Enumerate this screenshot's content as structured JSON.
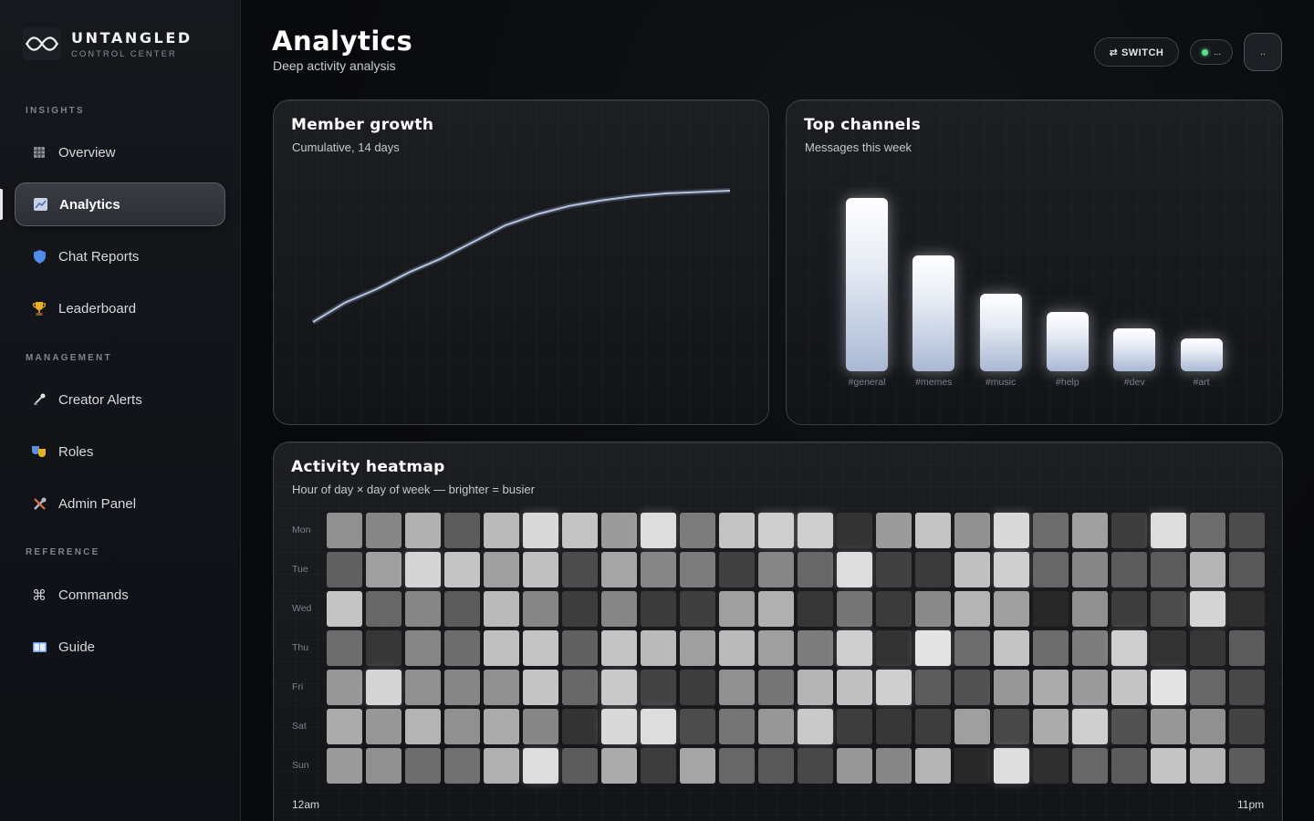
{
  "brand": {
    "name": "UNTANGLED",
    "subtitle": "CONTROL CENTER"
  },
  "sidebar": {
    "sections": [
      {
        "label": "INSIGHTS"
      },
      {
        "label": "MANAGEMENT"
      },
      {
        "label": "REFERENCE"
      }
    ],
    "items": [
      {
        "label": "Overview",
        "icon": "grid-icon"
      },
      {
        "label": "Analytics",
        "icon": "chart-icon",
        "active": true
      },
      {
        "label": "Chat Reports",
        "icon": "shield-icon"
      },
      {
        "label": "Leaderboard",
        "icon": "trophy-icon"
      },
      {
        "label": "Creator Alerts",
        "icon": "satellite-icon"
      },
      {
        "label": "Roles",
        "icon": "masks-icon"
      },
      {
        "label": "Admin Panel",
        "icon": "tools-icon"
      },
      {
        "label": "Commands",
        "icon": "command-icon"
      },
      {
        "label": "Guide",
        "icon": "book-icon"
      }
    ]
  },
  "header": {
    "title": "Analytics",
    "subtitle": "Deep activity analysis",
    "switch_label": "⇄ SWITCH",
    "status_text": "...",
    "avatar_text": ".."
  },
  "member_growth": {
    "title": "Member growth",
    "subtitle": "Cumulative, 14 days",
    "chart_data": {
      "type": "line",
      "x": [
        1,
        2,
        3,
        4,
        5,
        6,
        7,
        8,
        9,
        10,
        11,
        12,
        13,
        14
      ],
      "series": [
        {
          "values": [
            0,
            14,
            24,
            36,
            46,
            58,
            70,
            78,
            84,
            88,
            91,
            93,
            94,
            95
          ]
        }
      ],
      "color": "#b8c4dd"
    }
  },
  "top_channels": {
    "title": "Top channels",
    "subtitle": "Messages this week",
    "chart_data": {
      "type": "bar",
      "categories": [
        "#general",
        "#memes",
        "#music",
        "#help",
        "#dev",
        "#art"
      ],
      "values": [
        100,
        67,
        45,
        34,
        25,
        19
      ]
    }
  },
  "heatmap": {
    "title": "Activity heatmap",
    "subtitle": "Hour of day × day of week — brighter = busier",
    "x_start_label": "12am",
    "x_end_label": "11pm",
    "chart_data": {
      "type": "heatmap",
      "rows": [
        "Mon",
        "Tue",
        "Wed",
        "Thu",
        "Fri",
        "Sat",
        "Sun"
      ],
      "values": [
        [
          0.55,
          0.5,
          0.7,
          0.3,
          0.75,
          0.9,
          0.8,
          0.6,
          0.92,
          0.45,
          0.8,
          0.85,
          0.85,
          0.1,
          0.6,
          0.8,
          0.55,
          0.9,
          0.38,
          0.62,
          0.15,
          0.92,
          0.38,
          0.22
        ],
        [
          0.32,
          0.62,
          0.88,
          0.8,
          0.62,
          0.78,
          0.22,
          0.65,
          0.5,
          0.45,
          0.17,
          0.5,
          0.35,
          0.92,
          0.17,
          0.14,
          0.78,
          0.85,
          0.35,
          0.5,
          0.3,
          0.3,
          0.72,
          0.28
        ],
        [
          0.8,
          0.35,
          0.5,
          0.3,
          0.75,
          0.5,
          0.15,
          0.5,
          0.14,
          0.16,
          0.62,
          0.7,
          0.12,
          0.42,
          0.14,
          0.52,
          0.72,
          0.62,
          0.05,
          0.55,
          0.15,
          0.22,
          0.88,
          0.08
        ],
        [
          0.38,
          0.12,
          0.5,
          0.38,
          0.78,
          0.8,
          0.32,
          0.8,
          0.75,
          0.62,
          0.75,
          0.62,
          0.45,
          0.85,
          0.1,
          0.95,
          0.38,
          0.8,
          0.38,
          0.45,
          0.85,
          0.1,
          0.12,
          0.3
        ],
        [
          0.58,
          0.88,
          0.55,
          0.5,
          0.55,
          0.8,
          0.35,
          0.82,
          0.18,
          0.15,
          0.55,
          0.42,
          0.72,
          0.78,
          0.85,
          0.3,
          0.25,
          0.58,
          0.68,
          0.6,
          0.8,
          0.95,
          0.35,
          0.2
        ],
        [
          0.68,
          0.58,
          0.72,
          0.55,
          0.68,
          0.5,
          0.1,
          0.9,
          0.92,
          0.22,
          0.42,
          0.58,
          0.82,
          0.15,
          0.12,
          0.15,
          0.62,
          0.2,
          0.68,
          0.85,
          0.25,
          0.58,
          0.55,
          0.18
        ],
        [
          0.6,
          0.55,
          0.38,
          0.4,
          0.7,
          0.92,
          0.3,
          0.68,
          0.15,
          0.65,
          0.35,
          0.28,
          0.2,
          0.58,
          0.5,
          0.72,
          0.05,
          0.92,
          0.08,
          0.35,
          0.3,
          0.8,
          0.72,
          0.3
        ]
      ]
    }
  }
}
